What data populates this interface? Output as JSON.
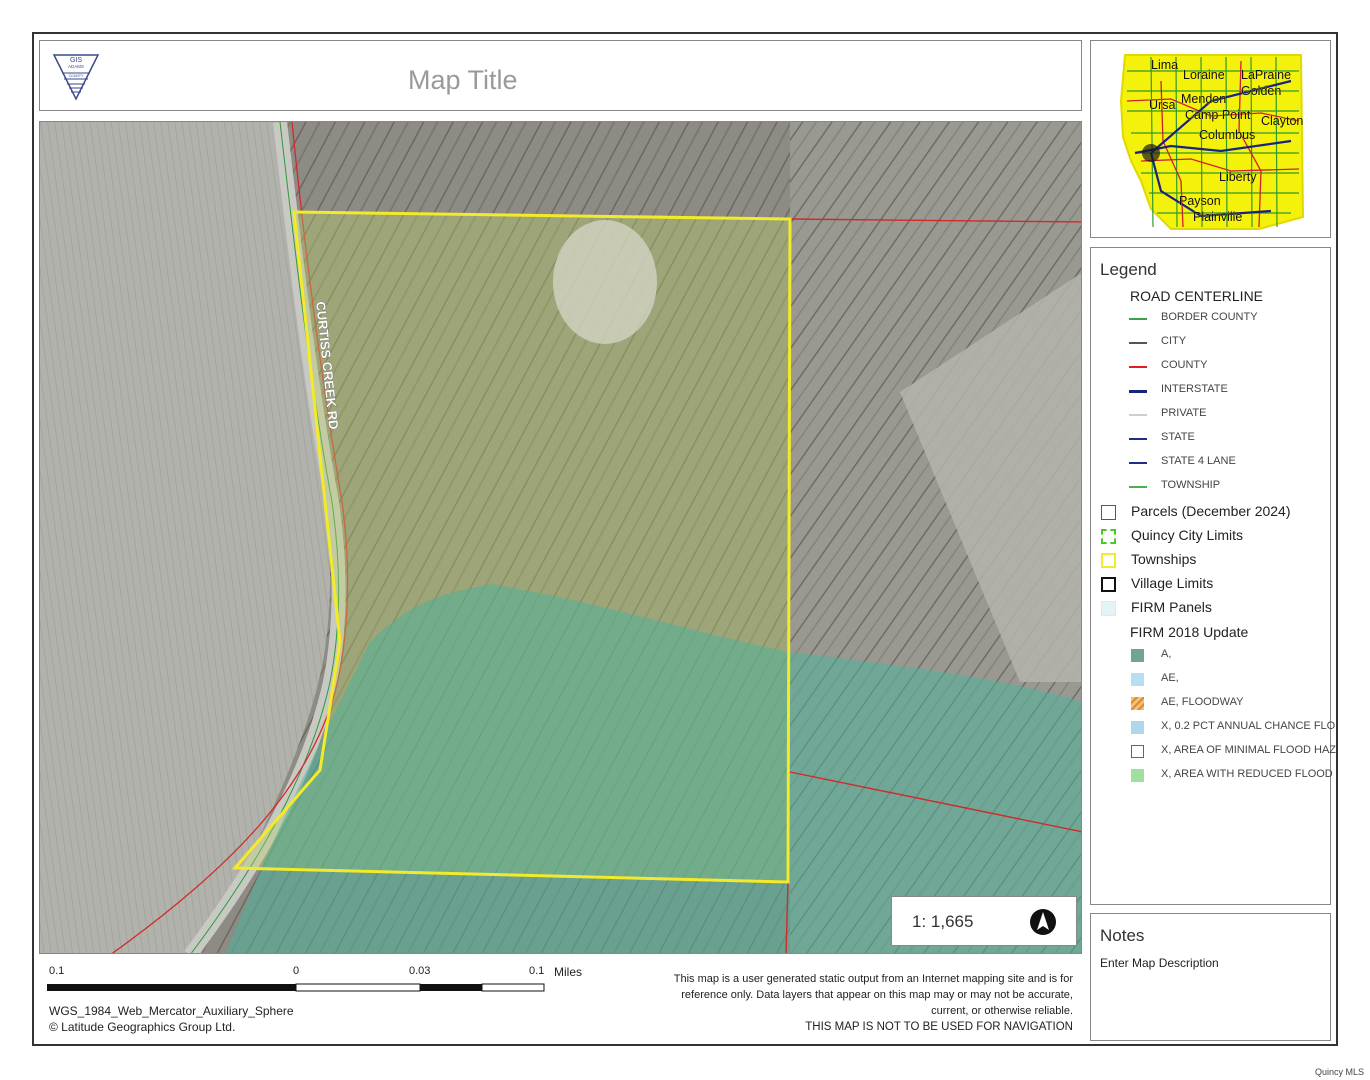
{
  "title": {
    "map_title": "Map Title",
    "logo_lines": [
      "GIS",
      "ADAMS",
      "COUNTY"
    ]
  },
  "overview": {
    "town_labels": [
      "Lima",
      "Loraine",
      "LaPraine",
      "Golden",
      "Ursa",
      "Mendon",
      "Camp Point",
      "Clayton",
      "Columbus",
      "Liberty",
      "Payson",
      "Plainville"
    ]
  },
  "map": {
    "road_label": "CURTISS CREEK RD",
    "scale_text": "1: 1,665",
    "north_arrow_icon": "north-arrow-icon"
  },
  "legend": {
    "heading": "Legend",
    "road_centerline": {
      "title": "ROAD CENTERLINE",
      "items": [
        {
          "label": "BORDER COUNTY",
          "color": "#3aa04a"
        },
        {
          "label": "CITY",
          "color": "#555555"
        },
        {
          "label": "COUNTY",
          "color": "#e02020"
        },
        {
          "label": "INTERSTATE",
          "color": "#1a237e"
        },
        {
          "label": "PRIVATE",
          "color": "#cfcfcf"
        },
        {
          "label": "STATE",
          "color": "#1f2d8a"
        },
        {
          "label": "STATE 4 LANE",
          "color": "#1f2d8a"
        },
        {
          "label": "TOWNSHIP",
          "color": "#4caf50"
        }
      ]
    },
    "layers": [
      {
        "label": "Parcels (December 2024)",
        "stroke": "#e02020",
        "fill": "#ffffff"
      },
      {
        "label": "Quincy City Limits",
        "stroke": "#44cc22",
        "fill": "#ffffff"
      },
      {
        "label": "Townships",
        "stroke": "#f2ea2a",
        "fill": "#ffffff"
      },
      {
        "label": "Village Limits",
        "stroke": "#111111",
        "fill": "#ffffff"
      },
      {
        "label": "FIRM Panels",
        "stroke": "#d8ecf2",
        "fill": "#e3f3f8"
      }
    ],
    "firm": {
      "title": "FIRM 2018 Update",
      "items": [
        {
          "label": "A,",
          "fill": "#6fa592"
        },
        {
          "label": "AE,",
          "fill": "#b7def2"
        },
        {
          "label": "AE, FLOODWAY",
          "fill": "#f2c27a"
        },
        {
          "label": "X, 0.2 PCT ANNUAL CHANCE FLO",
          "fill": "#b0d6ee"
        },
        {
          "label": "X, AREA OF MINIMAL FLOOD HAZ",
          "fill": "#ffffff"
        },
        {
          "label": "X, AREA WITH REDUCED FLOOD",
          "fill": "#9fe0a0"
        }
      ]
    }
  },
  "notes": {
    "heading": "Notes",
    "description": "Enter Map Description"
  },
  "scalebar": {
    "labels": [
      "0.1",
      "0",
      "0.03",
      "0.1"
    ],
    "units": "Miles"
  },
  "footer": {
    "projection": "WGS_1984_Web_Mercator_Auxiliary_Sphere",
    "copyright": "© Latitude Geographics Group Ltd.",
    "disclaimer_lines": [
      "This map is a user generated static output from an Internet mapping site and is for",
      "reference only. Data layers that appear on this map may or may not be accurate,",
      "current, or otherwise reliable.",
      "THIS MAP IS NOT TO BE USED FOR NAVIGATION"
    ]
  },
  "watermark": "Quincy MLS"
}
